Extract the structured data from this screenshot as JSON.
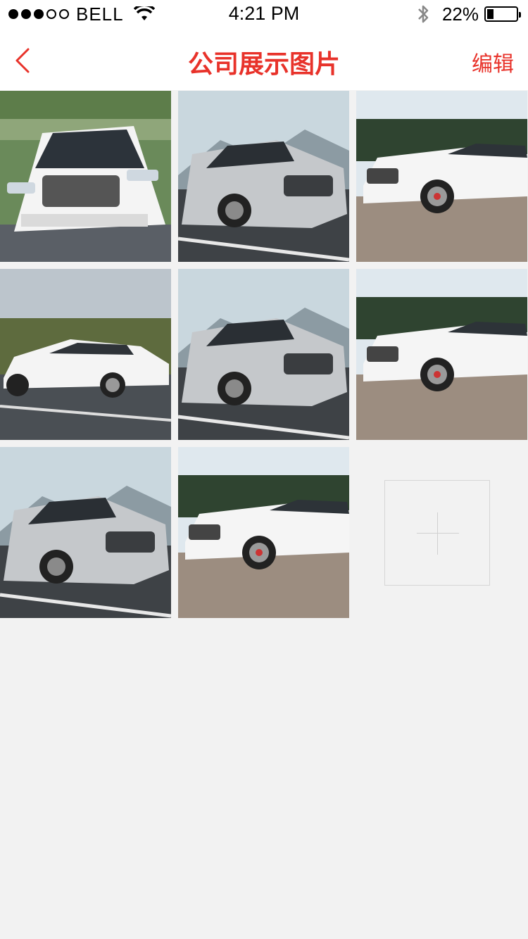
{
  "status_bar": {
    "carrier": "BELL",
    "time": "4:21 PM",
    "battery": "22%",
    "battery_level": 0.22,
    "signal_bars_filled": 3,
    "signal_bars_total": 5
  },
  "nav": {
    "back_icon": "chevron-left-icon",
    "title": "公司展示图片",
    "edit_label": "编辑",
    "accent_color": "#e8322a"
  },
  "photos": [
    {
      "scene": "front-road"
    },
    {
      "scene": "front-mountain"
    },
    {
      "scene": "side-paving"
    },
    {
      "scene": "side-hills"
    },
    {
      "scene": "front-mountain"
    },
    {
      "scene": "side-paving"
    },
    {
      "scene": "front-mountain"
    },
    {
      "scene": "side-paving"
    }
  ],
  "add_button": {
    "icon": "plus-icon"
  }
}
